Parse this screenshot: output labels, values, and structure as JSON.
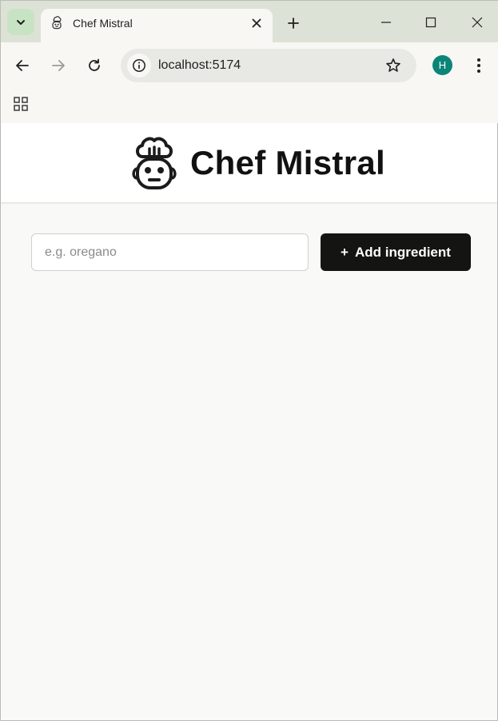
{
  "browser": {
    "tab": {
      "title": "Chef Mistral",
      "favicon": "chef-hat-face-icon"
    },
    "address": {
      "url": "localhost:5174"
    },
    "profile": {
      "initial": "H",
      "color": "#0b8578"
    }
  },
  "app": {
    "title": "Chef Mistral",
    "logo": "chef-robot-icon"
  },
  "form": {
    "input_placeholder": "e.g. oregano",
    "input_value": "",
    "add_button_icon": "+",
    "add_button_label": "Add ingredient"
  },
  "colors": {
    "accent": "#141413",
    "page_background": "#f9f9f7",
    "tab_strip": "#dde2d7"
  }
}
